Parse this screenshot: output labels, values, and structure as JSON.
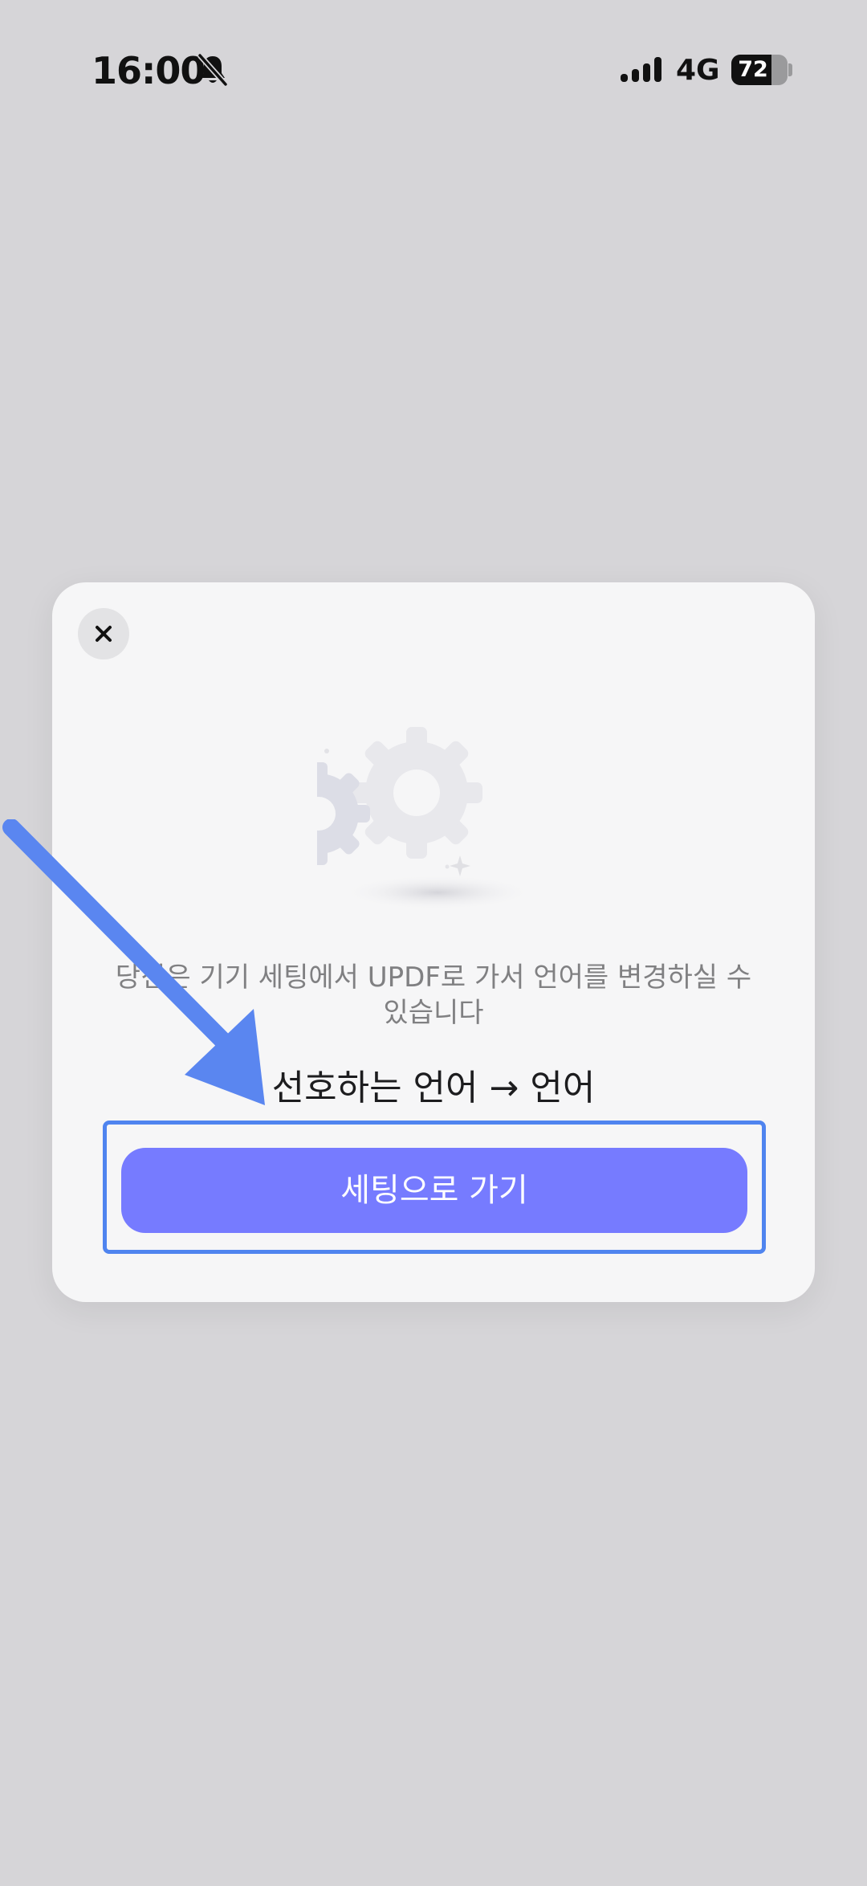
{
  "status_bar": {
    "time": "16:00",
    "network": "4G",
    "battery_level": "72",
    "battery_fraction": 0.72,
    "icons": [
      "bell-slash-icon",
      "signal-icon",
      "battery-icon"
    ]
  },
  "dialog": {
    "close_icon": "close-icon",
    "illustration": "gears-icon",
    "message": "당신은 기기 세팅에서 UPDF로 가서 언어를 변경하실 수 있습니다",
    "path": "선호하는 언어 → 언어",
    "button_label": "세팅으로 가기"
  },
  "colors": {
    "background": "#d6d5d8",
    "dialog_background": "#f6f6f7",
    "button": "#767bff",
    "highlight": "#4f84ef",
    "arrow": "#5a86f0"
  }
}
